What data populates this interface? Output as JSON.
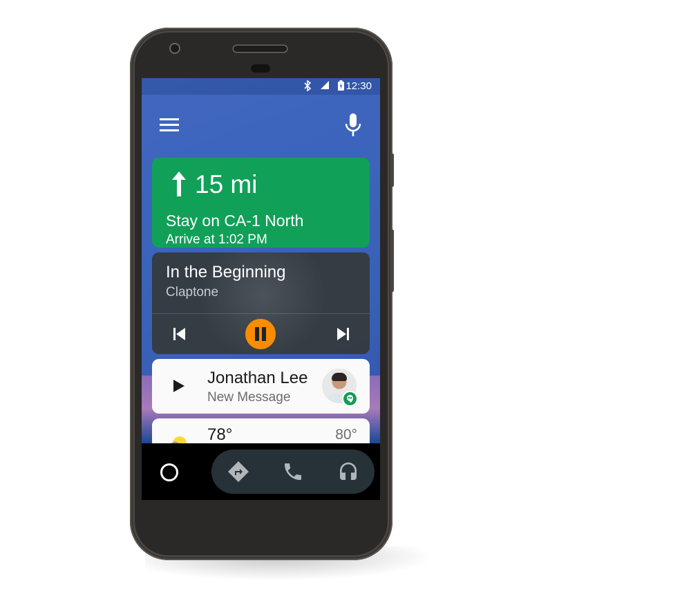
{
  "status_bar": {
    "time": "12:30",
    "icons": [
      "bluetooth-icon",
      "signal-icon",
      "battery-icon"
    ]
  },
  "header": {
    "menu_icon": "menu-icon",
    "voice_icon": "mic-icon"
  },
  "navigation_card": {
    "direction_icon": "arrow-up-icon",
    "distance": "15 mi",
    "instruction": "Stay on CA-1 North",
    "eta": "Arrive at 1:02 PM",
    "color": "#11a058"
  },
  "media_card": {
    "title": "In the Beginning",
    "artist": "Claptone",
    "controls": [
      "skip-previous-icon",
      "pause-icon",
      "skip-next-icon"
    ],
    "accent": "#fb8c00"
  },
  "message_card": {
    "name": "Jonathan Lee",
    "subtitle": "New Message",
    "action_icon": "play-icon",
    "app_badge": "hangouts-icon",
    "badge_color": "#0f9d58"
  },
  "weather_card": {
    "current_temp": "78°",
    "high_temp": "80°",
    "icon": "partly-cloudy-icon"
  },
  "bottom_bar": {
    "home_icon": "home-circle-icon",
    "apps": [
      "navigation-icon",
      "phone-icon",
      "headphones-icon"
    ]
  }
}
